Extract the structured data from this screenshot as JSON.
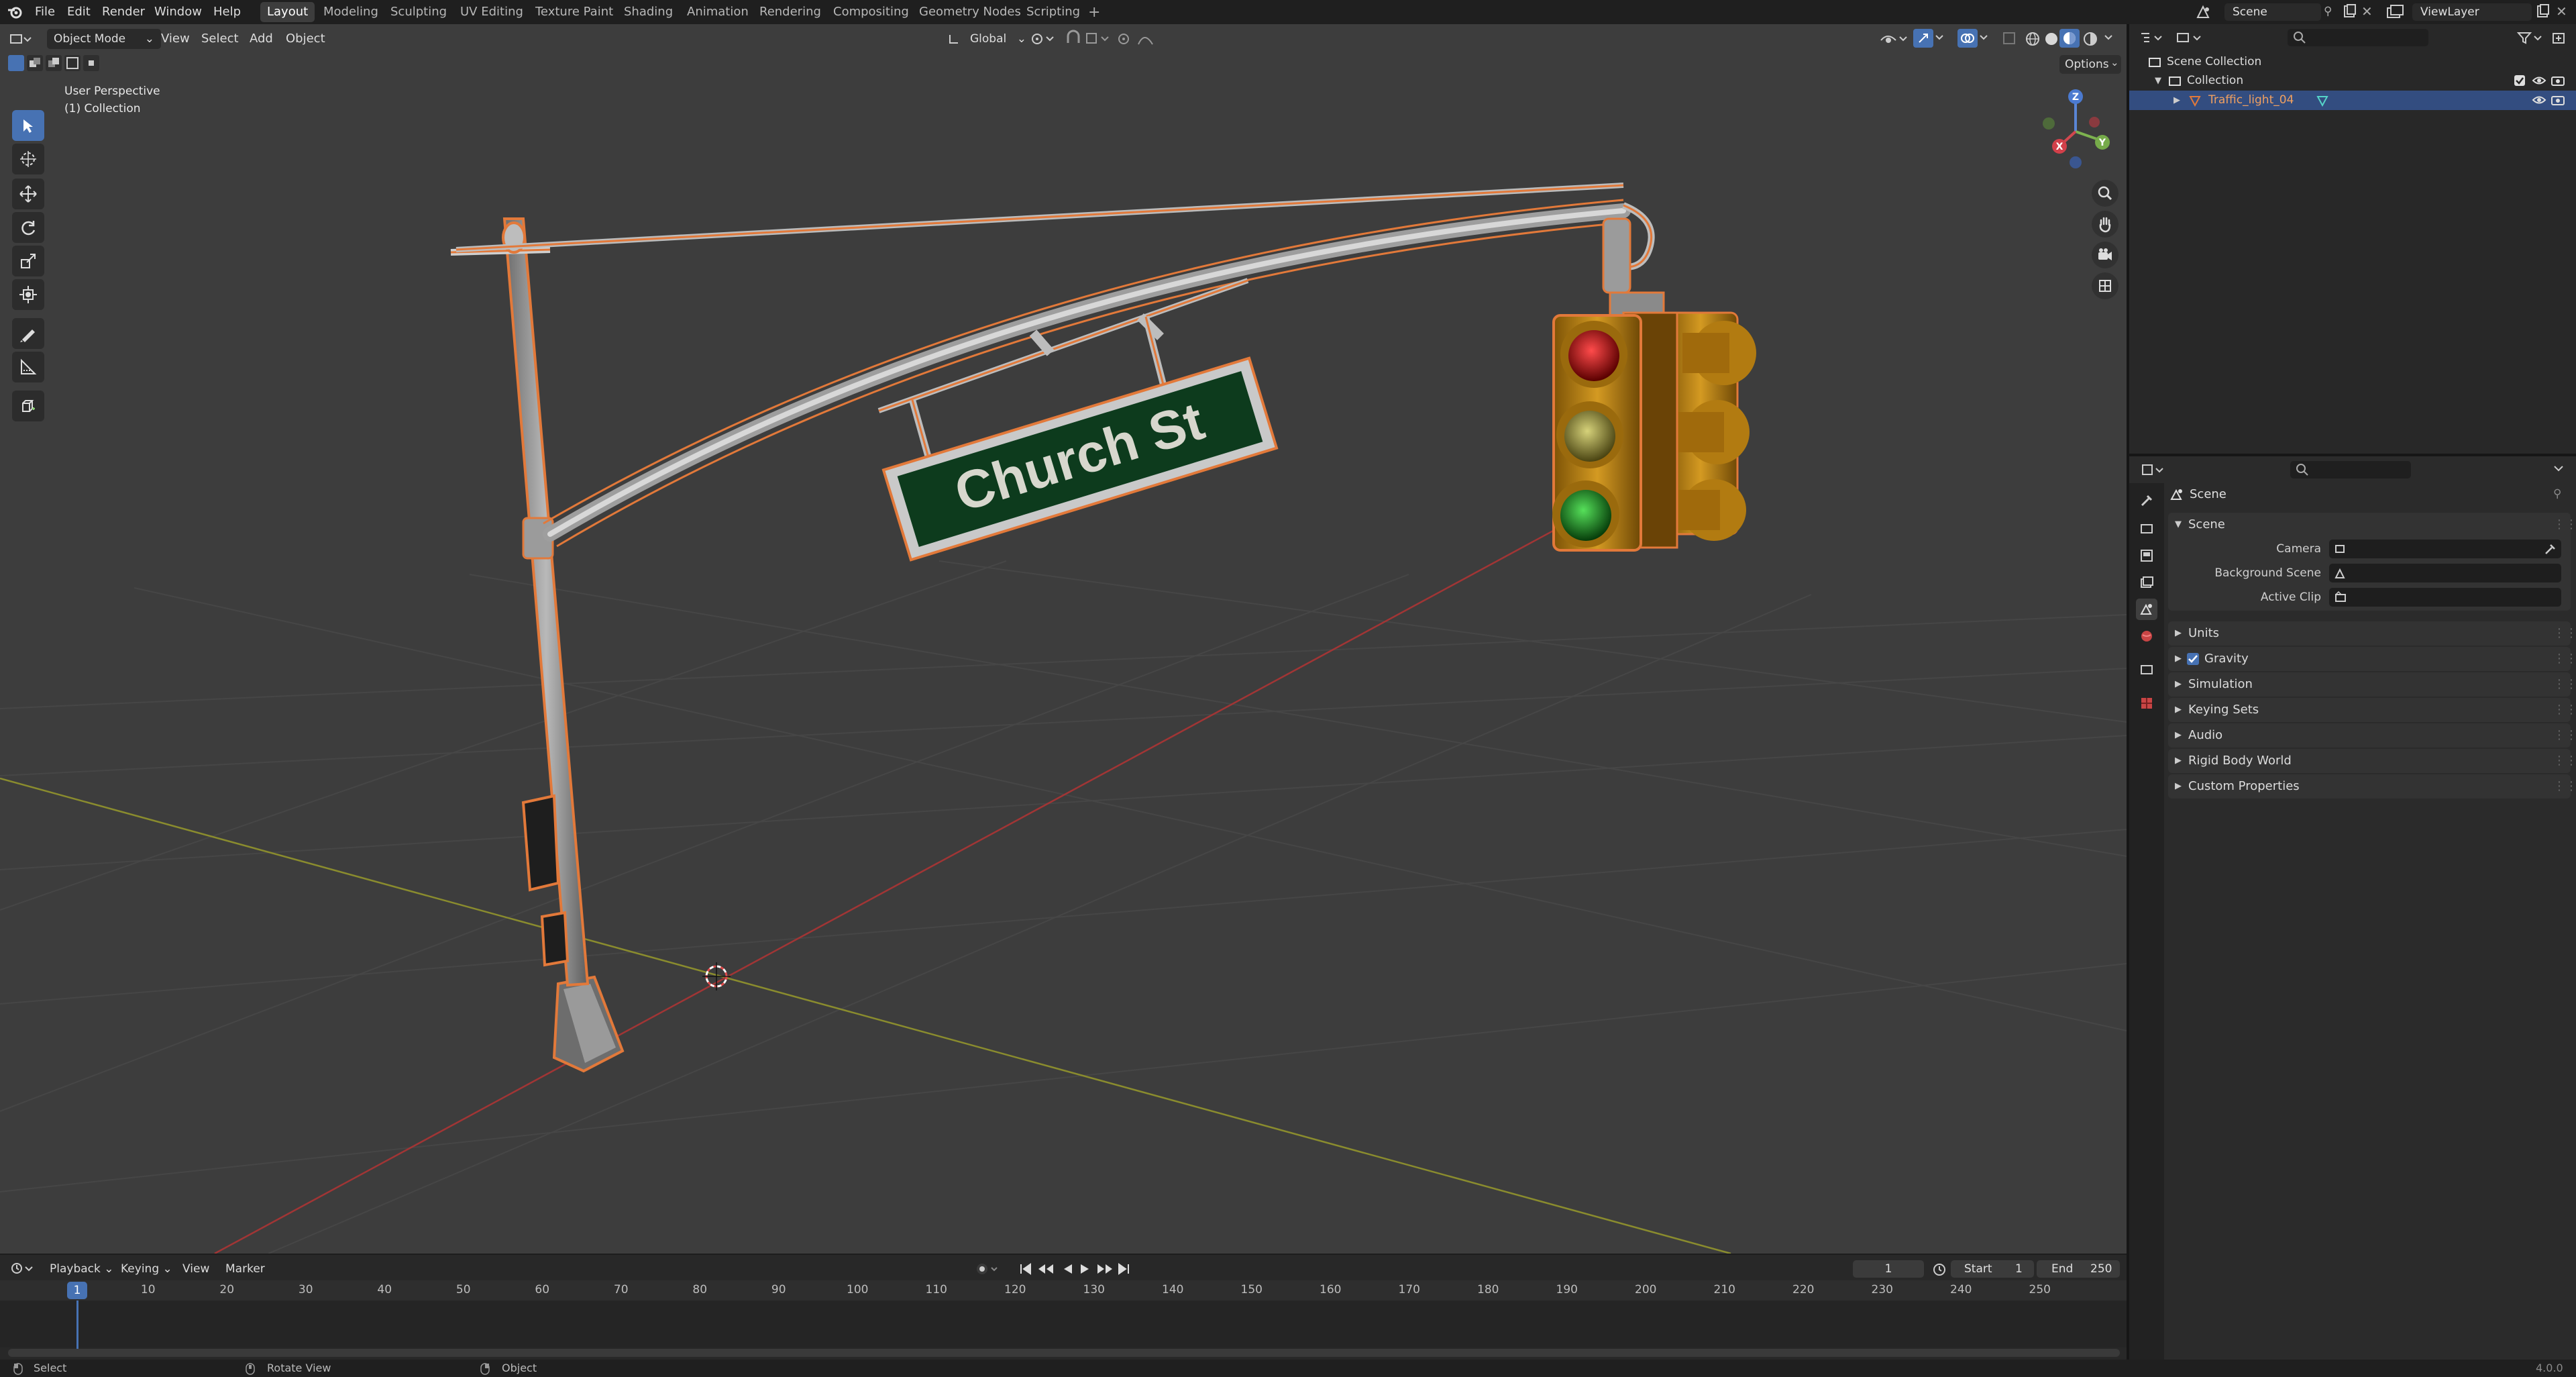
{
  "menu": {
    "items": [
      "File",
      "Edit",
      "Render",
      "Window",
      "Help"
    ]
  },
  "workspaces": {
    "tabs": [
      "Layout",
      "Modeling",
      "Sculpting",
      "UV Editing",
      "Texture Paint",
      "Shading",
      "Animation",
      "Rendering",
      "Compositing",
      "Geometry Nodes",
      "Scripting"
    ],
    "active": "Layout"
  },
  "top_right": {
    "scene_name": "Scene",
    "view_layer": "ViewLayer"
  },
  "viewport": {
    "mode": "Object Mode",
    "menus": [
      "View",
      "Select",
      "Add",
      "Object"
    ],
    "transform_orientation": "Global",
    "options_label": "Options",
    "perspective_label": "User Perspective",
    "collection_label": "(1) Collection",
    "gizmo_axes": {
      "x": "X",
      "y": "Y",
      "z": "Z"
    },
    "sign_text": "Church St"
  },
  "outliner": {
    "root": "Scene Collection",
    "collection": "Collection",
    "object": "Traffic_light_04"
  },
  "properties": {
    "context_title": "Scene",
    "panel_title": "Scene",
    "fields": [
      {
        "label": "Camera",
        "value": ""
      },
      {
        "label": "Background Scene",
        "value": ""
      },
      {
        "label": "Active Clip",
        "value": ""
      }
    ],
    "sections": [
      "Units",
      "Gravity",
      "Simulation",
      "Keying Sets",
      "Audio",
      "Rigid Body World",
      "Custom Properties"
    ],
    "gravity_checked": true
  },
  "timeline": {
    "menus": [
      "Playback",
      "Keying",
      "View",
      "Marker"
    ],
    "current_frame": "1",
    "start_label": "Start",
    "start": "1",
    "end_label": "End",
    "end": "250",
    "ticks": [
      "1",
      "10",
      "20",
      "30",
      "40",
      "50",
      "60",
      "70",
      "80",
      "90",
      "100",
      "110",
      "120",
      "130",
      "140",
      "150",
      "160",
      "170",
      "180",
      "190",
      "200",
      "210",
      "220",
      "230",
      "240",
      "250"
    ]
  },
  "statusbar": {
    "select": "Select",
    "rotate": "Rotate View",
    "object": "Object",
    "version": "4.0.0"
  },
  "colors": {
    "accent": "#4772b3",
    "selection_outline": "#e2793a",
    "viewport_bg": "#3d3d3d",
    "sign_green": "#0d3b1d"
  }
}
